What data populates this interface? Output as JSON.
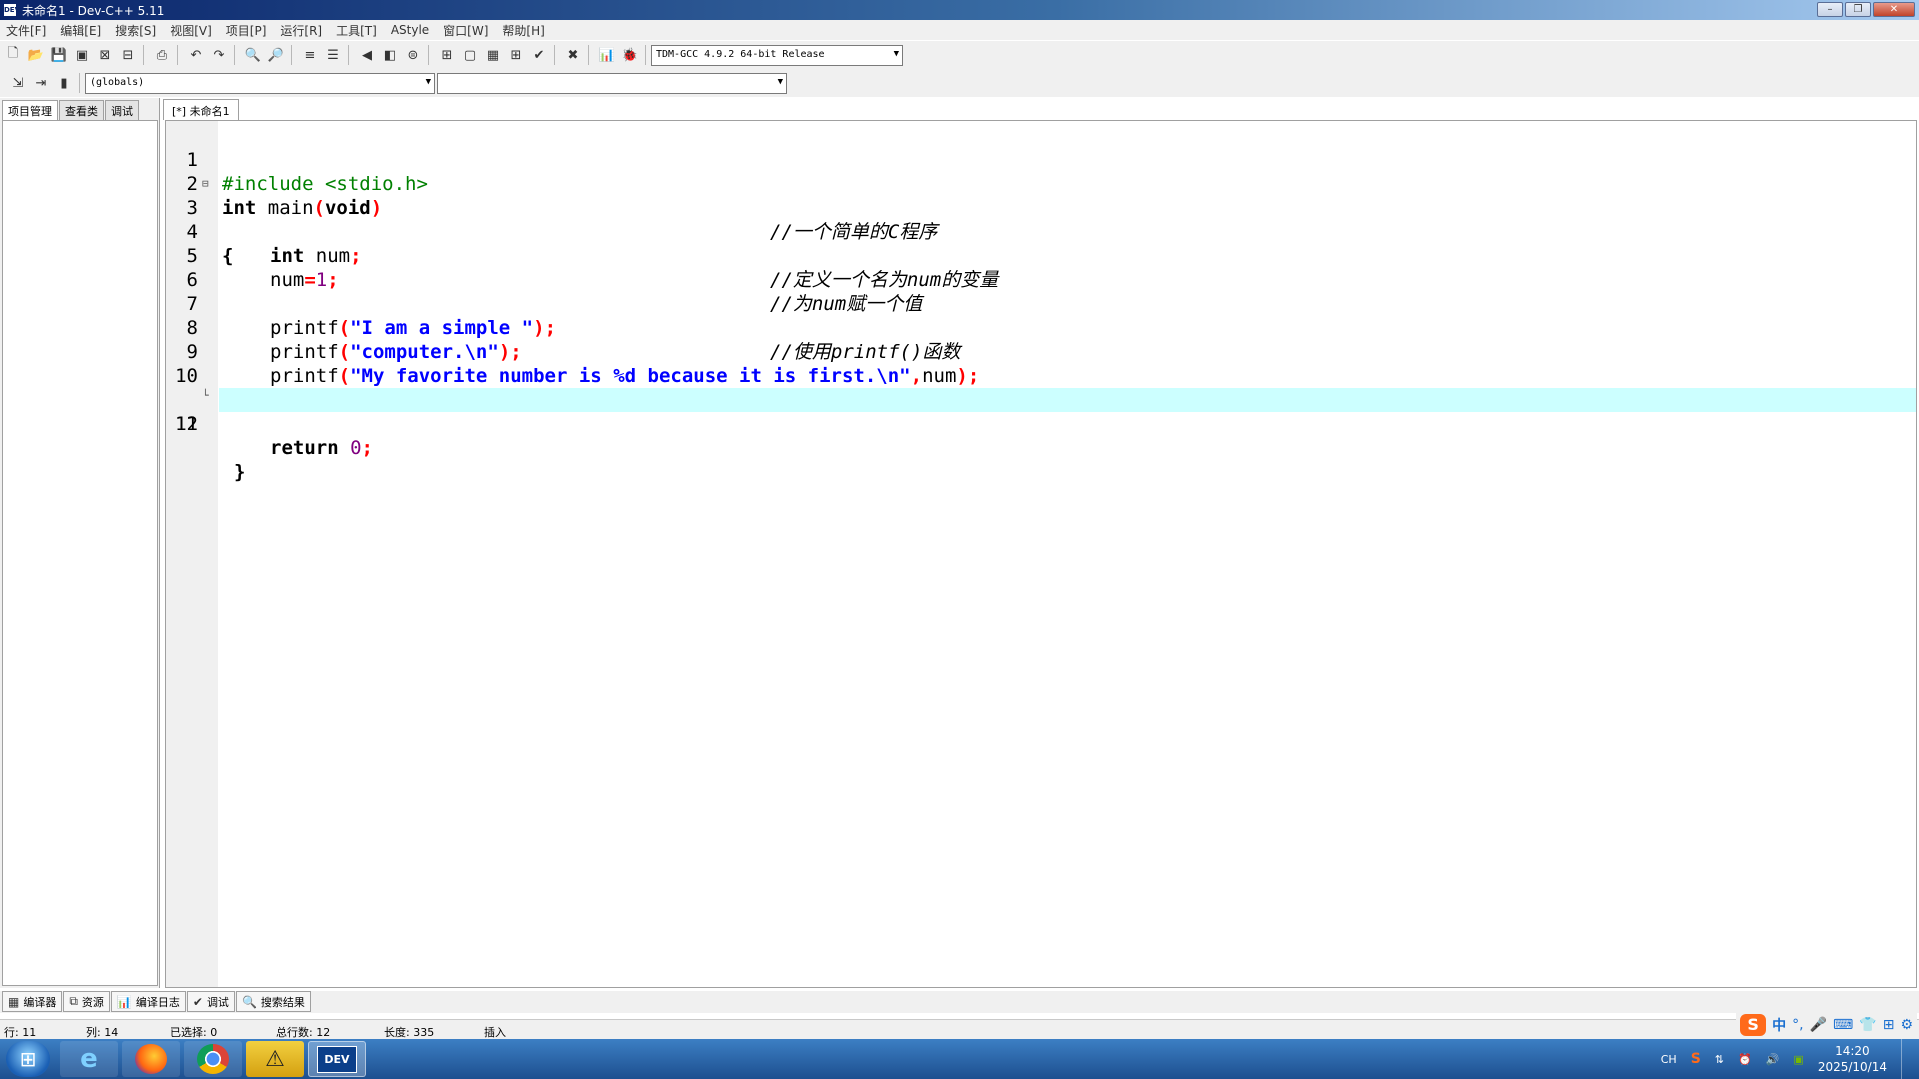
{
  "window": {
    "title": "未命名1 - Dev-C++ 5.11",
    "app_icon_text": "DEV"
  },
  "menu": [
    "文件[F]",
    "编辑[E]",
    "搜索[S]",
    "视图[V]",
    "项目[P]",
    "运行[R]",
    "工具[T]",
    "AStyle",
    "窗口[W]",
    "帮助[H]"
  ],
  "toolbar": {
    "compiler": "TDM-GCC 4.9.2 64-bit Release",
    "scope": "(globals)",
    "symbol": ""
  },
  "left_panel": {
    "tabs": [
      "项目管理",
      "查看类",
      "调试"
    ]
  },
  "editor": {
    "tab": "[*] 未命名1",
    "current_line": 11,
    "line_numbers": [
      "1",
      "2",
      "3",
      "4",
      "5",
      "6",
      "7",
      "8",
      "9",
      "10",
      "11",
      "12"
    ],
    "code": {
      "l1": "#include <stdio.h>",
      "l2_kw": "int",
      "l2_fn": " main",
      "l2_p1": "(",
      "l2_kw2": "void",
      "l2_p2": ")",
      "l2_cmt": "//一个简单的C程序",
      "l3": "{",
      "l4_kw": "int",
      "l4_id": " num",
      "l4_s": ";",
      "l4_cmt": "//定义一个名为num的变量",
      "l5_id": "num",
      "l5_eq": "=",
      "l5_num": "1",
      "l5_s": ";",
      "l5_cmt": "//为num赋一个值",
      "l7_fn": "printf",
      "l7_p1": "(",
      "l7_str": "\"I am a simple \"",
      "l7_p2": ");",
      "l7_cmt": "//使用printf()函数",
      "l8_fn": "printf",
      "l8_p1": "(",
      "l8_str": "\"computer.\\n\"",
      "l8_p2": ");",
      "l9_fn": "printf",
      "l9_p1": "(",
      "l9_str": "\"My favorite number is %d because it is first.\\n\"",
      "l9_c": ",",
      "l9_id": "num",
      "l9_p2": ");",
      "l11_kw": "return",
      "l11_num": "0",
      "l11_s": ";",
      "l12": "}"
    }
  },
  "bottom_tabs": [
    "编译器",
    "资源",
    "编译日志",
    "调试",
    "搜索结果"
  ],
  "status": {
    "row_label": "行:",
    "row": "11",
    "col_label": "列:",
    "col": "14",
    "sel_label": "已选择:",
    "sel": "0",
    "total_label": "总行数:",
    "total": "12",
    "len_label": "长度:",
    "len": "335",
    "mode": "插入"
  },
  "ime": {
    "lang": "中"
  },
  "taskbar": {
    "tray_lang": "CH",
    "clock_time": "14:20",
    "clock_date": "2025/10/14",
    "devcpp_label": "DEV"
  }
}
